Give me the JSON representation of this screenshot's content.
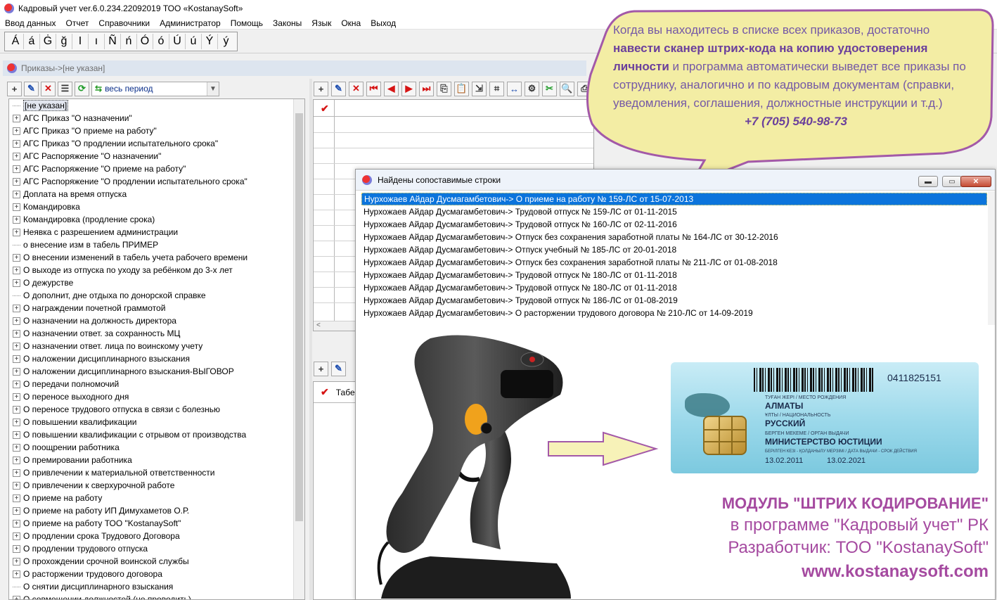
{
  "window": {
    "title": "Кадровый учет ver.6.0.234.22092019 ТОО «KostanaySoft»"
  },
  "menu": [
    "Ввод данных",
    "Отчет",
    "Справочники",
    "Администратор",
    "Помощь",
    "Законы",
    "Язык",
    "Окна",
    "Выход"
  ],
  "letters": [
    "Á",
    "á",
    "Ġ",
    "ğ",
    "I",
    "ı",
    "Ñ",
    "ń",
    "Ó",
    "ó",
    "Ú",
    "ú",
    "Ý",
    "ý"
  ],
  "child_window": {
    "caption": "Приказы->[не указан]"
  },
  "left_toolbar": {
    "period": "весь период"
  },
  "tree": {
    "selected": "[не указан]",
    "items": [
      {
        "label": "АГС Приказ \"О назначении\"",
        "expandable": true
      },
      {
        "label": "АГС Приказ \"О приеме на работу\"",
        "expandable": true
      },
      {
        "label": "АГС Приказ \"О продлении испытательного срока\"",
        "expandable": true
      },
      {
        "label": "АГС Распоряжение \"О назначении\"",
        "expandable": true
      },
      {
        "label": "АГС Распоряжение \"О приеме на работу\"",
        "expandable": true
      },
      {
        "label": "АГС Распоряжение \"О продлении испытательного срока\"",
        "expandable": true
      },
      {
        "label": "Доплата на время отпуска",
        "expandable": true
      },
      {
        "label": "Командировка",
        "expandable": true
      },
      {
        "label": "Командировка (продление срока)",
        "expandable": true
      },
      {
        "label": "Неявка с разрешением администрации",
        "expandable": true
      },
      {
        "label": "о внесение изм в табель ПРИМЕР",
        "expandable": false
      },
      {
        "label": "О внесении изменений в табель учета рабочего времени",
        "expandable": true
      },
      {
        "label": "О выходе из отпуска по уходу за ребёнком до 3-х лет",
        "expandable": true
      },
      {
        "label": "О дежурстве",
        "expandable": true
      },
      {
        "label": "О дополнит, дне отдыха по донорской справке",
        "expandable": false
      },
      {
        "label": "О награждении почетной граммотой",
        "expandable": true
      },
      {
        "label": "О назначении на должность директора",
        "expandable": true
      },
      {
        "label": "О назначении ответ. за сохранность МЦ",
        "expandable": true
      },
      {
        "label": "О назначении ответ. лица по воинскому учету",
        "expandable": true
      },
      {
        "label": "О наложении дисциплинарного взыскания",
        "expandable": true
      },
      {
        "label": "О наложении дисциплинарного взыскания-ВЫГОВОР",
        "expandable": true
      },
      {
        "label": "О передачи полномочий",
        "expandable": true
      },
      {
        "label": "О переносе выходного дня",
        "expandable": true
      },
      {
        "label": "О переносе трудового отпуска в связи с болезнью",
        "expandable": true
      },
      {
        "label": "О повышении квалификации",
        "expandable": true
      },
      {
        "label": "О повышении квалификации с отрывом от производства",
        "expandable": true
      },
      {
        "label": "О поощрении работника",
        "expandable": true
      },
      {
        "label": "О премировании работника",
        "expandable": true
      },
      {
        "label": "О привлечении к материальной ответственности",
        "expandable": true
      },
      {
        "label": "О привлечении к сверхурочной работе",
        "expandable": true
      },
      {
        "label": "О приеме на работу",
        "expandable": true
      },
      {
        "label": "О приеме на работу ИП Димухаметов О.Р.",
        "expandable": true
      },
      {
        "label": "О приеме на работу ТОО \"KostanaySoft\"",
        "expandable": true
      },
      {
        "label": "О продлении срока Трудового Договора",
        "expandable": true
      },
      {
        "label": "О продлении трудового отпуска",
        "expandable": true
      },
      {
        "label": "О прохождении срочной воинской службы",
        "expandable": true
      },
      {
        "label": "О расторжении трудового договора",
        "expandable": true
      },
      {
        "label": "О снятии дисциплинарного взыскания",
        "expandable": false
      },
      {
        "label": "О совмещении должностей (не проводить)",
        "expandable": true
      }
    ]
  },
  "grid2": {
    "header": "Табе"
  },
  "dialog": {
    "title": "Найдены сопоставимые строки",
    "rows": [
      "Нурхожаев Айдар Дусмагамбетович-> О приеме на работу № 159-ЛС от 15-07-2013",
      "Нурхожаев Айдар Дусмагамбетович-> Трудовой отпуск № 159-ЛС от 01-11-2015",
      "Нурхожаев Айдар Дусмагамбетович-> Трудовой отпуск № 160-ЛС от 02-11-2016",
      "Нурхожаев Айдар Дусмагамбетович-> Отпуск без сохранения заработной платы № 164-ЛС от 30-12-2016",
      "Нурхожаев Айдар Дусмагамбетович-> Отпуск учебный № 185-ЛС от 20-01-2018",
      "Нурхожаев Айдар Дусмагамбетович-> Отпуск без сохранения заработной платы № 211-ЛС от 01-08-2018",
      "Нурхожаев Айдар Дусмагамбетович-> Трудовой отпуск № 180-ЛС от 01-11-2018",
      "Нурхожаев Айдар Дусмагамбетович-> Трудовой отпуск № 180-ЛС от 01-11-2018",
      "Нурхожаев Айдар Дусмагамбетович-> Трудовой отпуск № 186-ЛС от 01-08-2019",
      "Нурхожаев Айдар Дусмагамбетович-> О расторжении трудового договора № 210-ЛС от 14-09-2019"
    ]
  },
  "id_card": {
    "number": "0411825151",
    "birthplace_label": "ТУҒАН ЖЕРІ / МЕСТО РОЖДЕНИЯ",
    "birthplace": "АЛМАТЫ",
    "nationality_label": "ҰЛТЫ / НАЦИОНАЛЬНОСТЬ",
    "nationality": "РУССКИЙ",
    "issuer_label": "БЕРГЕН МЕКЕМЕ / ОРГАН ВЫДАЧИ",
    "issuer": "МИНИСТЕРСТВО ЮСТИЦИИ",
    "dates_label": "БЕРІЛГЕН КЕЗІ - ҚОЛДАНЫЛУ МЕРЗІМІ / ДАТА ВЫДАЧИ - СРОК ДЕЙСТВИЯ",
    "issued": "13.02.2011",
    "expires": "13.02.2021"
  },
  "brand": {
    "line1": "МОДУЛЬ \"ШТРИХ КОДИРОВАНИЕ\"",
    "line2": "в программе \"Кадровый учет\" РК",
    "line3": "Разработчик: ТОО \"KostanaySoft\"",
    "line4": "www.kostanaysoft.com"
  },
  "callout": {
    "part1": "Когда вы находитесь в списке всех приказов, достаточно ",
    "part2": "навести сканер штрих-кода на копию удостоверения личности",
    "part3": " и программа автоматически выведет все приказы по сотруднику, аналогично и по кадровым документам (справки, уведомления, соглашения, должностные инструкции и т.д.)",
    "phone": "+7 (705) 540-98-73"
  },
  "colors": {
    "callout_fill": "#f3eda4",
    "callout_border": "#a359a8",
    "brand_text": "#a54aa0",
    "selection": "#0b74dc"
  }
}
